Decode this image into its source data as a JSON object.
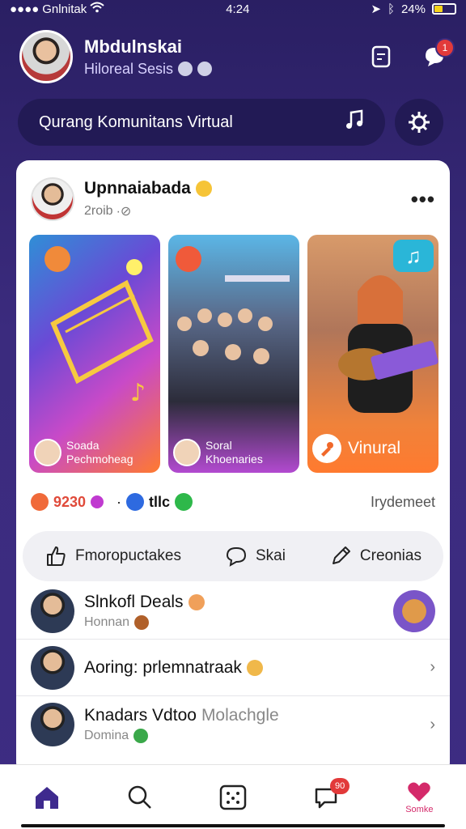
{
  "status_bar": {
    "carrier": "Gnlnitak",
    "time": "4:24",
    "battery_pct": "24%"
  },
  "header": {
    "user_name": "Mbdulnskai",
    "user_sub": "Hiloreal Sesis"
  },
  "notifications": {
    "count": "1"
  },
  "search": {
    "placeholder": "Qurang Komunitans Virtual"
  },
  "post": {
    "author": "Upnnaiabada",
    "time": "2roib",
    "tiles": [
      {
        "line1": "Soada",
        "line2": "Pechmoheag"
      },
      {
        "line1": "Soral",
        "line2": "Khoenaries"
      },
      {
        "label": "Vinural"
      }
    ],
    "stats_left": "9230",
    "stats_mid": "tllc",
    "stats_right": "Irydemeet",
    "actions": [
      "Fmoropuctakes",
      "Skai",
      "Creonias"
    ]
  },
  "rows": [
    {
      "title": "Slnkofl Deals",
      "sub": "Honnan"
    },
    {
      "title": "Aoring: prlemnatraak",
      "sub": ""
    },
    {
      "title": "Knadars Vdtoo",
      "title_extra": "Molachgle",
      "sub": "Domina"
    }
  ],
  "bottom_nav": {
    "messages_badge": "90",
    "profile_label": "Somke"
  },
  "colors": {
    "background": "#3b2b7e",
    "accent_purple": "#4a2fa0",
    "badge_red": "#e23a3a"
  }
}
